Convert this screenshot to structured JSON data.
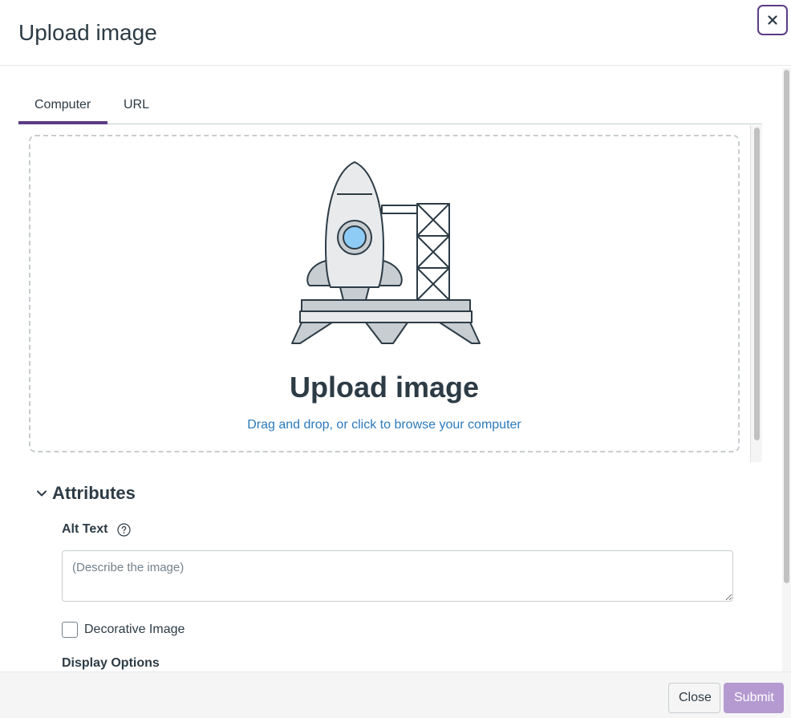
{
  "header": {
    "title": "Upload image",
    "close_icon": "close-icon"
  },
  "tabs": [
    {
      "label": "Computer",
      "selected": true
    },
    {
      "label": "URL",
      "selected": false
    }
  ],
  "dropzone": {
    "illustration": "rocket-launch-illustration",
    "title": "Upload image",
    "subtitle": "Drag and drop, or click to browse your computer"
  },
  "attributes": {
    "label": "Attributes",
    "toggle_icon": "chevron-down-icon",
    "alt_text_label": "Alt Text",
    "alt_text_help_icon": "help-circle-icon",
    "alt_text_value": "",
    "alt_text_placeholder": "(Describe the image)",
    "decorative_label": "Decorative Image",
    "decorative_checked": false,
    "display_options_label": "Display Options"
  },
  "footer": {
    "close_label": "Close",
    "submit_label": "Submit"
  },
  "colors": {
    "accent": "#5c3c84",
    "link": "#2b7abc",
    "text": "#2d3b45",
    "submit_disabled": "#b49ad0"
  }
}
